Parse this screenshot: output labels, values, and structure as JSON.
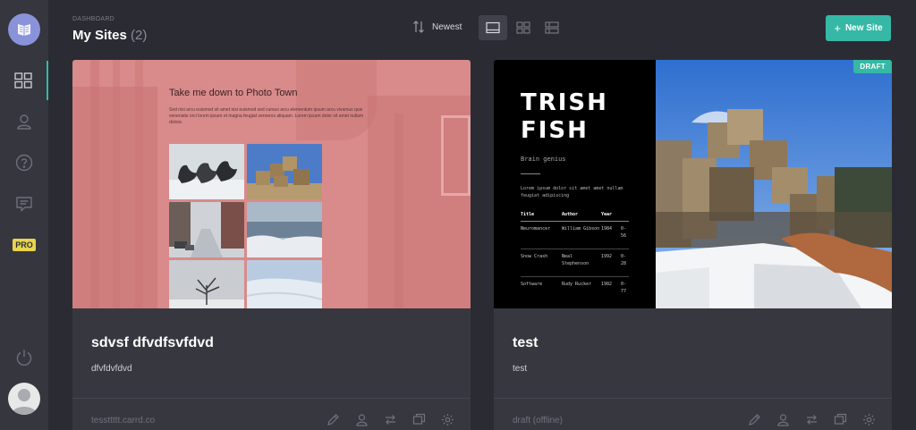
{
  "header": {
    "breadcrumb": "DASHBOARD",
    "title": "My Sites",
    "count": "(2)",
    "sort_label": "Newest",
    "new_site_label": "New Site"
  },
  "sidebar": {
    "items": [
      {
        "name": "sites",
        "icon": "grid-icon",
        "active": true
      },
      {
        "name": "account",
        "icon": "user-icon"
      },
      {
        "name": "help",
        "icon": "help-icon"
      },
      {
        "name": "feedback",
        "icon": "chat-icon"
      },
      {
        "name": "pro",
        "label": "PRO"
      }
    ],
    "bottom": [
      {
        "name": "logout",
        "icon": "power-icon"
      }
    ]
  },
  "sites": [
    {
      "name": "sdvsf dfvdfsvfdvd",
      "description": "dfvfdvfdvd",
      "url": "tessttttt.carrd.co",
      "thumbnail": {
        "heading": "Take me down to Photo Town",
        "body": "Sed nisi arcu euismod sit amet nisi euismod sed cursus arcu elementum ipsum arcu vivamus quis venenatis orci lorem ipsum et magna feugiat veroeros aliquam. Lorem ipsum dolor sit amet nullam dolore."
      }
    },
    {
      "name": "test",
      "description": "test",
      "url": "draft (offline)",
      "badge": "DRAFT",
      "thumbnail": {
        "title": "TRISH FISH",
        "subtitle": "Brain genius",
        "lorem": "Lorem ipsum dolor sit amet amet nullam feugiat adipiscing",
        "table": {
          "headers": [
            "Title",
            "Author",
            "Year"
          ],
          "rows": [
            [
              "Neuromancer",
              "William Gibson",
              "1984",
              "0-56"
            ],
            [
              "Snow Crash",
              "Neal Stephenson",
              "1992",
              "0-28"
            ],
            [
              "Software",
              "Rudy Rucker",
              "1982",
              "0-77"
            ]
          ]
        }
      }
    }
  ],
  "colors": {
    "accent": "#36b8a6",
    "background": "#2b2c33",
    "sidebar": "#35363e",
    "card": "#37383f",
    "pro_badge": "#e8d44d"
  }
}
